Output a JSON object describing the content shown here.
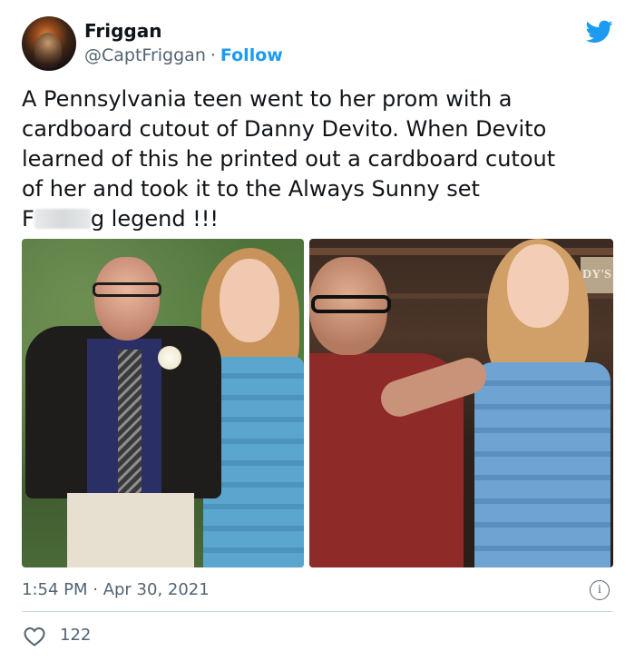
{
  "author": {
    "name": "Friggan",
    "handle": "@CaptFriggan",
    "separator": "·",
    "follow_label": "Follow"
  },
  "tweet": {
    "line1": "A Pennsylvania teen went to her prom with a",
    "line2": "cardboard cutout of Danny Devito. When Devito",
    "line3": "learned of this he printed out a cardboard cutout",
    "line4": "of her and took it to the Always Sunny set",
    "line5_start": "F",
    "line5_end": "g legend !!!"
  },
  "photo_right_sign": "DY'S",
  "meta": {
    "time": "1:54 PM · Apr 30, 2021",
    "info_glyph": "i"
  },
  "actions": {
    "likes": "122"
  },
  "colors": {
    "accent": "#1d9bf0",
    "secondary_text": "#536471",
    "divider": "#cfd9de"
  },
  "icons": {
    "brand": "twitter-bird-icon",
    "info": "info-icon",
    "like": "heart-icon"
  }
}
